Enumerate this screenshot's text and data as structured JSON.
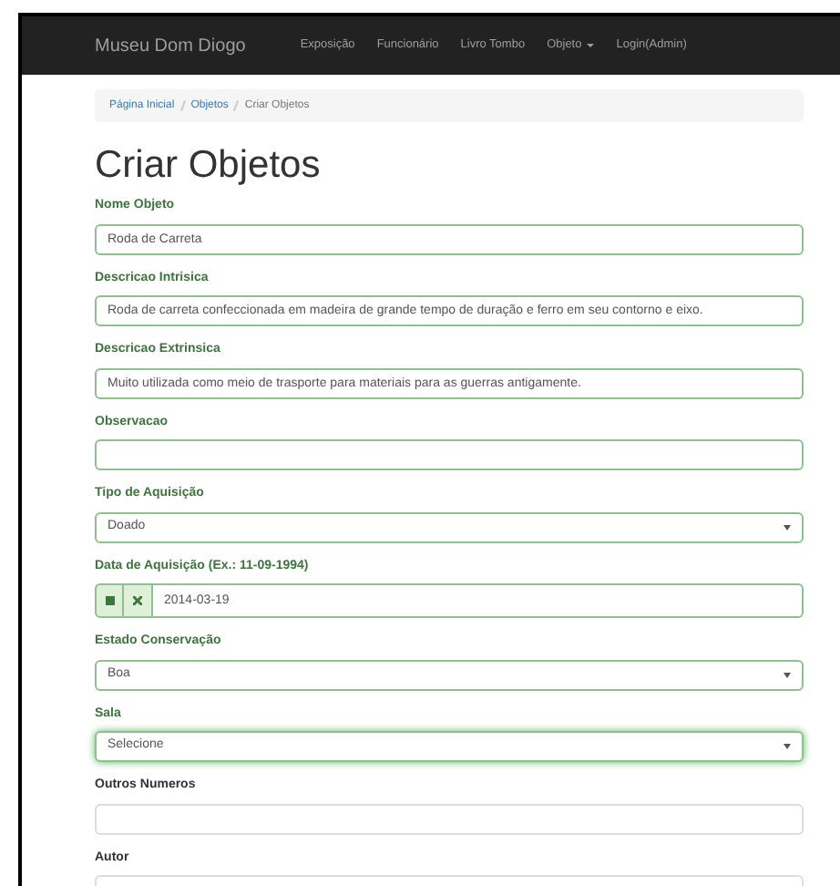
{
  "navbar": {
    "brand": "Museu Dom Diogo",
    "links": [
      {
        "label": "Exposição",
        "dropdown": false
      },
      {
        "label": "Funcionário",
        "dropdown": false
      },
      {
        "label": "Livro Tombo",
        "dropdown": false
      },
      {
        "label": "Objeto",
        "dropdown": true
      },
      {
        "label": "Login(Admin)",
        "dropdown": false
      }
    ]
  },
  "breadcrumb": [
    {
      "label": "Página Inicial",
      "current": false
    },
    {
      "label": "Objetos",
      "current": false
    },
    {
      "label": "Criar Objetos",
      "current": true
    }
  ],
  "title": "Criar Objetos",
  "fields": [
    {
      "kind": "text",
      "label": "Nome Objeto",
      "value": "Roda de Carreta",
      "valid": true,
      "focused": false
    },
    {
      "kind": "text",
      "label": "Descricao Intrisica",
      "value": "Roda de carreta confeccionada em madeira de grande tempo de duração e ferro em seu contorno e eixo.",
      "valid": true,
      "focused": false
    },
    {
      "kind": "text",
      "label": "Descricao Extrinsica",
      "value": "Muito utilizada como meio de trasporte para materiais para as guerras antigamente.",
      "valid": true,
      "focused": false
    },
    {
      "kind": "text",
      "label": "Observacao",
      "valid": true,
      "focused": false
    },
    {
      "kind": "select",
      "label": "Tipo de Aquisição",
      "value": "Doado",
      "valid": true,
      "focused": false
    },
    {
      "kind": "date",
      "label": "Data de Aquisição (Ex.: 11-09-1994)",
      "value": "2014-03-19",
      "valid": true,
      "focused": false
    },
    {
      "kind": "select",
      "label": "Estado Conservação",
      "value": "Boa",
      "valid": true,
      "focused": false
    },
    {
      "kind": "select",
      "label": "Sala",
      "value": "Selecione",
      "valid": true,
      "focused": true
    },
    {
      "kind": "text",
      "label": "Outros Numeros",
      "valid": false,
      "focused": false
    },
    {
      "kind": "text",
      "label": "Autor",
      "valid": false,
      "focused": false
    }
  ]
}
